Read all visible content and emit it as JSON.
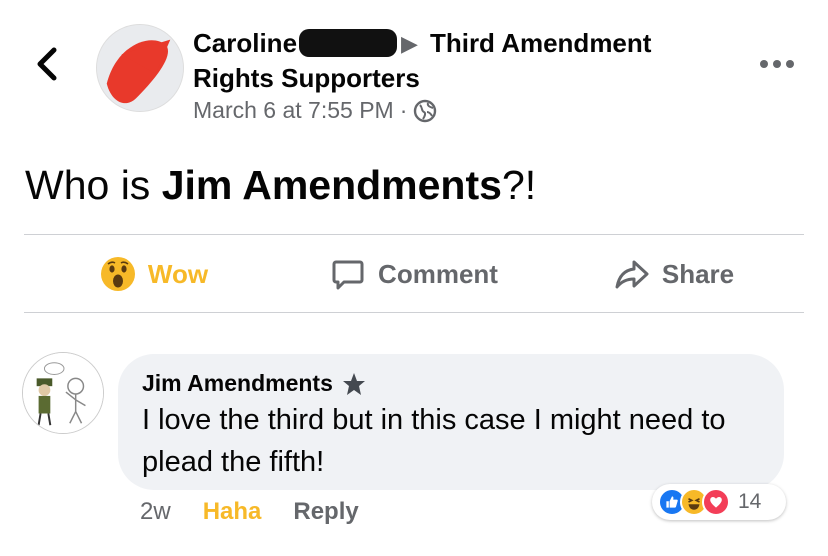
{
  "post": {
    "author_first": "Caroline",
    "group_part1": "Third Amendment",
    "group_part2": "Rights Supporters",
    "timestamp": "March 6 at 7:55 PM",
    "separator": "·",
    "text_prefix": "Who is ",
    "text_bold": "Jim Amendments",
    "text_suffix": "?!"
  },
  "actions": {
    "wow_label": "Wow",
    "comment_label": "Comment",
    "share_label": "Share"
  },
  "comment": {
    "author": "Jim Amendments",
    "text": "I love the third but in this case I might need to plead the fifth!",
    "time": "2w",
    "haha_label": "Haha",
    "reply_label": "Reply",
    "reaction_count": "14"
  },
  "colors": {
    "accent_yellow": "#f7b928",
    "muted": "#65676b",
    "bubble": "#f0f2f5",
    "like_blue": "#1877f2",
    "love_red": "#f33e58"
  },
  "icons": [
    "back-chevron-icon",
    "more-dots-icon",
    "globe-icon",
    "wow-emoji-icon",
    "comment-icon",
    "share-icon",
    "star-icon",
    "like-icon",
    "haha-icon",
    "love-icon"
  ]
}
